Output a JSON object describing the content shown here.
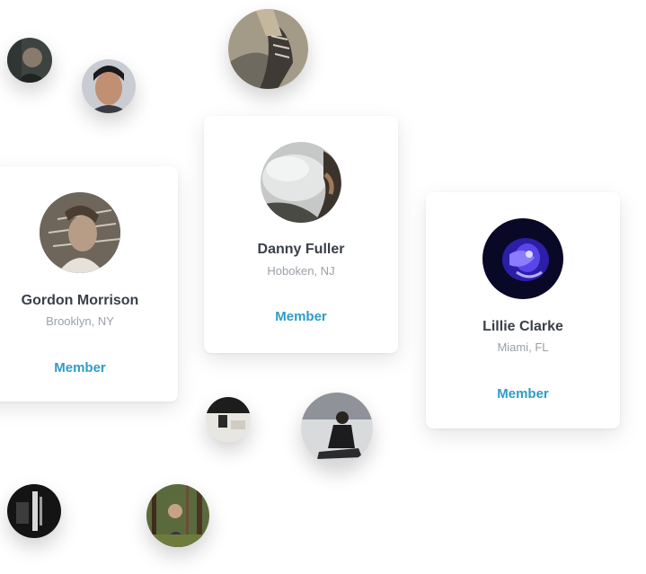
{
  "cards": [
    {
      "name": "Gordon Morrison",
      "location": "Brooklyn, NY",
      "role": "Member"
    },
    {
      "name": "Danny Fuller",
      "location": "Hoboken, NJ",
      "role": "Member"
    },
    {
      "name": "Lillie Clarke",
      "location": "Miami, FL",
      "role": "Member"
    }
  ],
  "colors": {
    "accent": "#2f9cc6",
    "name_text": "#3a4049",
    "location_text": "#9aa1a8",
    "background": "#ffffff"
  },
  "icons": {
    "avatars": [
      "person-photo-icon"
    ]
  }
}
